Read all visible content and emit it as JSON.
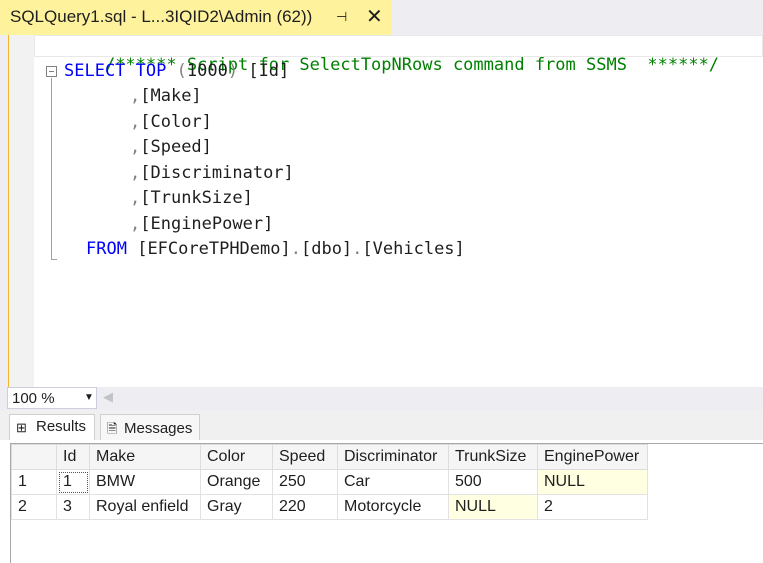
{
  "tab": {
    "title": "SQLQuery1.sql - L...3IQID2\\Admin (62))",
    "pin_icon": "pin-icon",
    "close_icon": "close-icon"
  },
  "editor": {
    "lines": [
      {
        "comment": "/****** Script for SelectTopNRows command from SSMS  ******/"
      },
      {
        "kw1": "SELECT",
        "kw2": "TOP",
        "p1": "(",
        "num": "1000",
        "p2": ")",
        "rest": " [Id]"
      },
      {
        "comma": ",",
        "col": "[Make]"
      },
      {
        "comma": ",",
        "col": "[Color]"
      },
      {
        "comma": ",",
        "col": "[Speed]"
      },
      {
        "comma": ",",
        "col": "[Discriminator]"
      },
      {
        "comma": ",",
        "col": "[TrunkSize]"
      },
      {
        "comma": ",",
        "col": "[EnginePower]"
      },
      {
        "kw": "FROM",
        "t1": "[EFCoreTPHDemo]",
        "d1": ".",
        "t2": "[dbo]",
        "d2": ".",
        "t3": "[Vehicles]"
      }
    ]
  },
  "status": {
    "zoom": "100 %"
  },
  "results_tabs": {
    "results": "Results",
    "messages": "Messages"
  },
  "grid": {
    "columns": [
      "",
      "Id",
      "Make",
      "Color",
      "Speed",
      "Discriminator",
      "TrunkSize",
      "EnginePower"
    ],
    "rows": [
      [
        "1",
        "1",
        "BMW",
        "Orange",
        "250",
        "Car",
        "500",
        "NULL"
      ],
      [
        "2",
        "3",
        "Royal enfield",
        "Gray",
        "220",
        "Motorcycle",
        "NULL",
        "2"
      ]
    ]
  }
}
